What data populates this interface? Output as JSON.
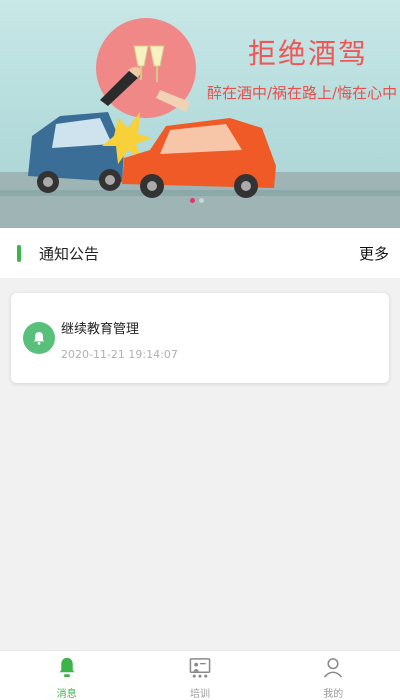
{
  "banner": {
    "title": "拒绝酒驾",
    "subtitle": "醉在酒中/祸在路上/悔在心中",
    "slides": 2,
    "active_slide": 1
  },
  "notice": {
    "title": "通知公告",
    "more": "更多"
  },
  "cards": [
    {
      "title": "继续教育管理",
      "time": "2020-11-21 19:14:07",
      "icon": "bell-icon"
    }
  ],
  "bottom_nav": {
    "items": [
      {
        "label": "消息",
        "icon": "bell-icon",
        "active": true
      },
      {
        "label": "培训",
        "icon": "training-icon",
        "active": false
      },
      {
        "label": "我的",
        "icon": "user-icon",
        "active": false
      }
    ]
  },
  "colors": {
    "accent": "#3cb44a",
    "banner_red": "#ef5757",
    "card_icon_bg": "#59c07c",
    "inactive": "#9a9a9a"
  }
}
